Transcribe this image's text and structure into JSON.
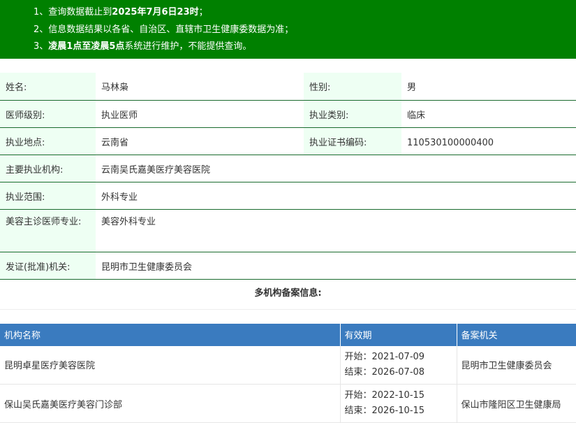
{
  "notice": {
    "l1_pre": "1、查询数据截止到",
    "l1_bold": "2025年7月6日23时",
    "l1_post": "；",
    "l2": "2、信息数据结果以各省、自治区、直辖市卫生健康委数据为准；",
    "l3_pre": "3、",
    "l3_bold": "凌晨1点至凌晨5点",
    "l3_post": "系统进行维护，不能提供查询。"
  },
  "doctor": {
    "name_label": "姓名:",
    "name": "马林枭",
    "gender_label": "性别:",
    "gender": "男",
    "level_label": "医师级别:",
    "level": "执业医师",
    "category_label": "执业类别:",
    "category": "临床",
    "location_label": "执业地点:",
    "location": "云南省",
    "cert_label": "执业证书编码:",
    "cert": "110530100000400",
    "org_label": "主要执业机构:",
    "org": "云南吴氏嘉美医疗美容医院",
    "scope_label": "执业范围:",
    "scope": "外科专业",
    "cosmetic_label": "美容主诊医师专业:",
    "cosmetic": "美容外科专业",
    "issuer_label": "发证(批准)机关:",
    "issuer": "昆明市卫生健康委员会"
  },
  "multi": {
    "title": "多机构备案信息:",
    "headers": [
      "机构名称",
      "有效期",
      "备案机关"
    ],
    "rows": [
      {
        "name": "昆明卓星医疗美容医院",
        "start": "开始：2021-07-09",
        "end": "结束：2026-07-08",
        "authority": "昆明市卫生健康委员会"
      },
      {
        "name": "保山吴氏嘉美医疗美容门诊部",
        "start": "开始：2022-10-15",
        "end": "结束：2026-10-15",
        "authority": "保山市隆阳区卫生健康局"
      }
    ]
  }
}
